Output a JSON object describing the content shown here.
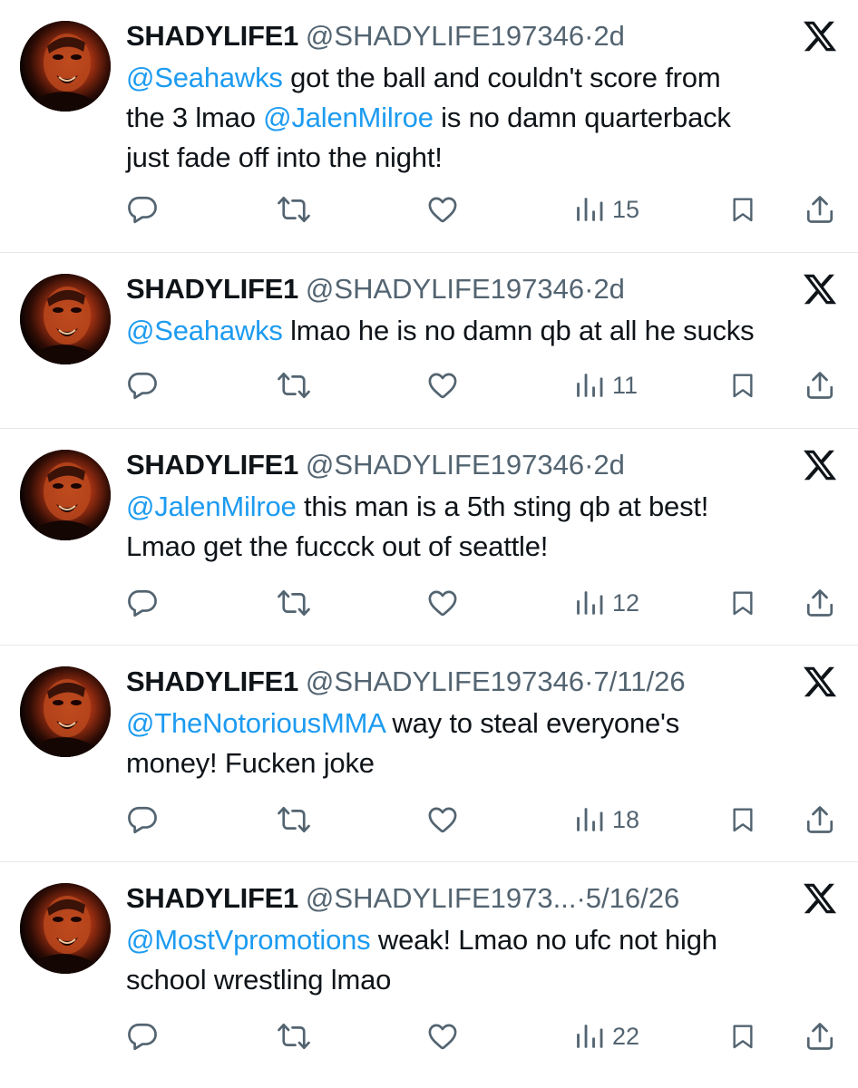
{
  "tweets": [
    {
      "name": "SHADYLIFE1",
      "handle": "@SHADYLIFE197346",
      "dot": "·",
      "time": "2d",
      "lines": [
        [
          {
            "t": "@Seahawks",
            "m": true
          },
          {
            "t": " got the ball and couldn't score from",
            "m": false
          }
        ],
        [
          {
            "t": "the 3 lmao ",
            "m": false
          },
          {
            "t": "@JalenMilroe",
            "m": true
          },
          {
            "t": " is no damn quarterback",
            "m": false
          }
        ],
        [
          {
            "t": "just fade off into the night!",
            "m": false
          }
        ]
      ],
      "views": "15"
    },
    {
      "name": "SHADYLIFE1",
      "handle": "@SHADYLIFE197346",
      "dot": "·",
      "time": "2d",
      "lines": [
        [
          {
            "t": "@Seahawks",
            "m": true
          },
          {
            "t": " lmao he is no damn qb at all he sucks",
            "m": false
          }
        ]
      ],
      "views": "11"
    },
    {
      "name": "SHADYLIFE1",
      "handle": "@SHADYLIFE197346",
      "dot": "·",
      "time": "2d",
      "lines": [
        [
          {
            "t": "@JalenMilroe",
            "m": true
          },
          {
            "t": " this man is a 5th sting qb at best!",
            "m": false
          }
        ],
        [
          {
            "t": "Lmao get the fuccck out of seattle!",
            "m": false
          }
        ]
      ],
      "views": "12"
    },
    {
      "name": "SHADYLIFE1",
      "handle": "@SHADYLIFE197346",
      "dot": "·",
      "time": "7/11/26",
      "lines": [
        [
          {
            "t": "@TheNotoriousMMA",
            "m": true
          },
          {
            "t": " way to steal everyone's",
            "m": false
          }
        ],
        [
          {
            "t": "money! Fucken joke",
            "m": false
          }
        ]
      ],
      "views": "18"
    },
    {
      "name": "SHADYLIFE1",
      "handle": "@SHADYLIFE1973...",
      "dot": "·",
      "time": "5/16/26",
      "lines": [
        [
          {
            "t": "@MostVpromotions",
            "m": true
          },
          {
            "t": " weak! Lmao no ufc not high",
            "m": false
          }
        ],
        [
          {
            "t": "school wrestling lmao",
            "m": false
          }
        ]
      ],
      "views": "22"
    }
  ],
  "icons": {
    "close": "x-close-icon",
    "reply": "reply-icon",
    "retweet": "retweet-icon",
    "like": "heart-icon",
    "views": "views-bar-chart-icon",
    "bookmark": "bookmark-icon",
    "share": "share-icon"
  },
  "colors": {
    "mention": "#1d9bf0",
    "secondary_text": "#536471",
    "primary_text": "#0f1419",
    "divider": "#e6e9ec"
  }
}
